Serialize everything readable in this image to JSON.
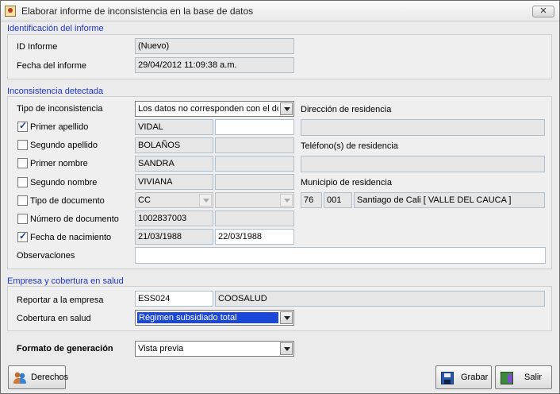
{
  "window": {
    "title": "Elaborar informe de inconsistencia en la base de datos",
    "close_symbol": "✕"
  },
  "identificacion": {
    "title": "Identificación del informe",
    "id_label": "ID Informe",
    "id_value": "(Nuevo)",
    "fecha_label": "Fecha del informe",
    "fecha_value": "29/04/2012 11:09:38 a.m."
  },
  "inconsistencia": {
    "title": "Inconsistencia detectada",
    "tipo_label": "Tipo de inconsistencia",
    "tipo_value": "Los datos no corresponden con el do",
    "rows": [
      {
        "label": "Primer apellido",
        "checked": true,
        "current": "VIDAL",
        "new": ""
      },
      {
        "label": "Segundo apellido",
        "checked": false,
        "current": "BOLAÑOS",
        "new": ""
      },
      {
        "label": "Primer nombre",
        "checked": false,
        "current": "SANDRA",
        "new": ""
      },
      {
        "label": "Segundo nombre",
        "checked": false,
        "current": "VIVIANA",
        "new": ""
      },
      {
        "label": "Tipo de documento",
        "checked": false,
        "current": "CC",
        "new": ""
      },
      {
        "label": "Número de documento",
        "checked": false,
        "current": "1002837003",
        "new": ""
      },
      {
        "label": "Fecha de nacimiento",
        "checked": true,
        "current": "21/03/1988",
        "new": "22/03/1988"
      }
    ],
    "observaciones_label": "Observaciones",
    "observaciones_value": "",
    "direccion_label": "Dirección de residencia",
    "direccion_value": "",
    "telefono_label": "Teléfono(s) de residencia",
    "telefono_value": "",
    "municipio_label": "Municipio de residencia",
    "municipio_dep": "76",
    "municipio_code": "001",
    "municipio_name": "Santiago de Cali [ VALLE DEL CAUCA ]"
  },
  "empresa": {
    "title": "Empresa y cobertura en salud",
    "reportar_label": "Reportar a la empresa",
    "empresa_code": "ESS024",
    "empresa_name": "COOSALUD",
    "cobertura_label": "Cobertura en salud",
    "cobertura_value": "Régimen subsidiado total"
  },
  "formato": {
    "label": "Formato de generación",
    "value": "Vista previa"
  },
  "buttons": {
    "derechos": "Derechos",
    "grabar": "Grabar",
    "salir": "Salir"
  }
}
